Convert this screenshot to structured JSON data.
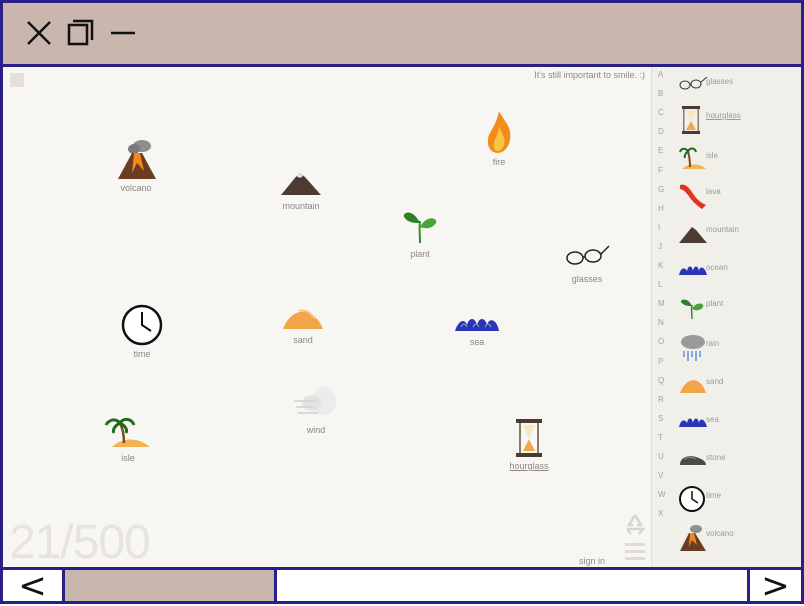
{
  "window": {
    "close_icon": "close-icon",
    "restore_icon": "restore-icon",
    "minimize_icon": "minimize-icon",
    "titlebar_color": "#c9b6ac",
    "border_color": "#2a1f86"
  },
  "game": {
    "tagline": "It's still important to smile. :)",
    "counter": "21/500",
    "sign_in": "sign in",
    "elements": [
      {
        "name": "volcano",
        "icon": "volcano-icon"
      },
      {
        "name": "mountain",
        "icon": "mountain-icon"
      },
      {
        "name": "fire",
        "icon": "fire-icon"
      },
      {
        "name": "plant",
        "icon": "plant-icon"
      },
      {
        "name": "glasses",
        "icon": "glasses-icon"
      },
      {
        "name": "time",
        "icon": "clock-icon"
      },
      {
        "name": "sand",
        "icon": "sand-icon"
      },
      {
        "name": "sea",
        "icon": "sea-icon"
      },
      {
        "name": "wind",
        "icon": "wind-icon"
      },
      {
        "name": "isle",
        "icon": "isle-icon"
      },
      {
        "name": "hourglass",
        "icon": "hourglass-icon"
      }
    ]
  },
  "sidebar": {
    "letters": [
      "A",
      "B",
      "C",
      "D",
      "E",
      "F",
      "G",
      "H",
      "I",
      "J",
      "K",
      "L",
      "M",
      "N",
      "O",
      "P",
      "Q",
      "R",
      "S",
      "T",
      "U",
      "V",
      "W",
      "X"
    ],
    "items": [
      {
        "label": "glasses",
        "icon": "glasses-icon"
      },
      {
        "label": "hourglass",
        "icon": "hourglass-icon"
      },
      {
        "label": "isle",
        "icon": "isle-icon"
      },
      {
        "label": "lava",
        "icon": "lava-icon"
      },
      {
        "label": "mountain",
        "icon": "mountain-icon"
      },
      {
        "label": "ocean",
        "icon": "ocean-icon"
      },
      {
        "label": "plant",
        "icon": "plant-icon"
      },
      {
        "label": "rain",
        "icon": "rain-icon"
      },
      {
        "label": "sand",
        "icon": "sand-icon"
      },
      {
        "label": "sea",
        "icon": "sea-icon"
      },
      {
        "label": "stone",
        "icon": "stone-icon"
      },
      {
        "label": "time",
        "icon": "clock-icon"
      },
      {
        "label": "volcano",
        "icon": "volcano-icon"
      }
    ]
  },
  "bottombar": {
    "prev": "<",
    "next": ">"
  }
}
